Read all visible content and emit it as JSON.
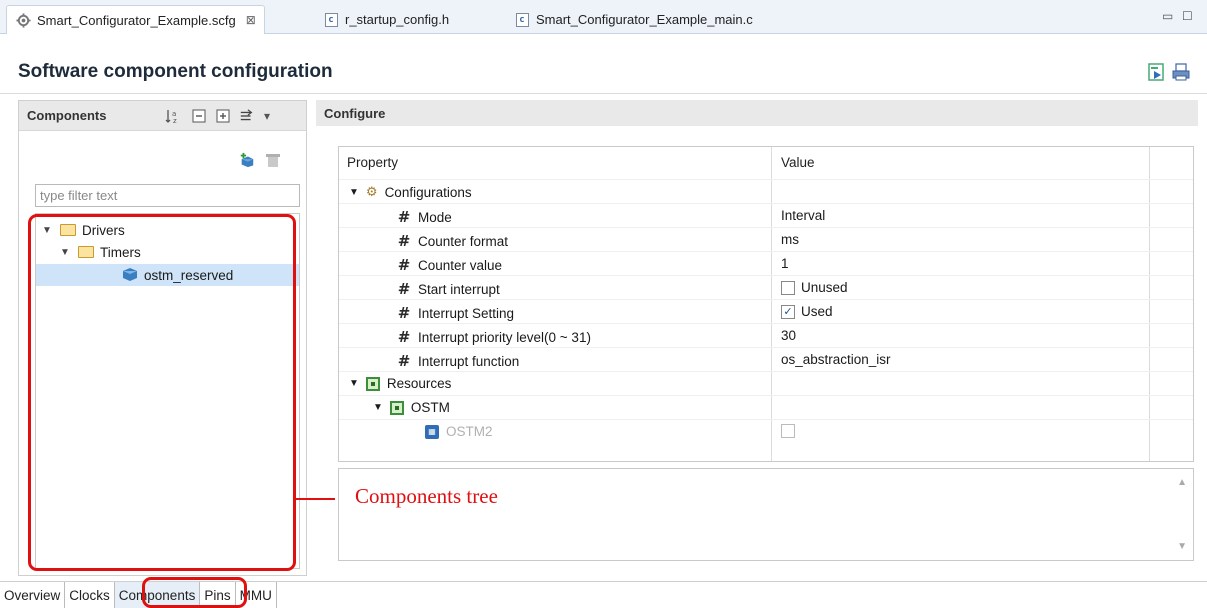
{
  "editor_tabs": [
    {
      "label": "Smart_Configurator_Example.scfg",
      "icon": "gear-icon",
      "close": "⊠"
    },
    {
      "label": "r_startup_config.h",
      "icon": "c-file-icon"
    },
    {
      "label": "Smart_Configurator_Example_main.c",
      "icon": "c-file-icon"
    }
  ],
  "window_controls": {
    "minimize": "▭",
    "maximize": "☐"
  },
  "page_title": "Software component configuration",
  "components_panel": {
    "title": "Components",
    "filter_placeholder": "type filter text",
    "tree": [
      {
        "label": "Drivers",
        "level": 0,
        "expanded": true,
        "icon": "folder-icon"
      },
      {
        "label": "Timers",
        "level": 1,
        "expanded": true,
        "icon": "folder-icon"
      },
      {
        "label": "ostm_reserved",
        "level": 2,
        "selected": true,
        "icon": "component-icon"
      }
    ]
  },
  "configure_panel": {
    "title": "Configure",
    "columns": {
      "property": "Property",
      "value": "Value"
    },
    "rows": [
      {
        "name": "Configurations",
        "type": "group",
        "value": ""
      },
      {
        "name": "Mode",
        "type": "prop",
        "value": "Interval"
      },
      {
        "name": "Counter format",
        "type": "prop",
        "value": "ms"
      },
      {
        "name": "Counter value",
        "type": "prop",
        "value": "1"
      },
      {
        "name": "Start interrupt",
        "type": "prop",
        "value": "Unused",
        "checked": false
      },
      {
        "name": "Interrupt Setting",
        "type": "prop",
        "value": "Used",
        "checked": true
      },
      {
        "name": "Interrupt priority level(0 ~ 31)",
        "type": "prop",
        "value": "30"
      },
      {
        "name": "Interrupt function",
        "type": "prop",
        "value": "os_abstraction_isr"
      },
      {
        "name": "Resources",
        "type": "group",
        "value": ""
      },
      {
        "name": "OSTM",
        "type": "subgroup",
        "value": ""
      },
      {
        "name": "OSTM2",
        "type": "resource",
        "value": "",
        "checked": false,
        "disabled": true
      }
    ]
  },
  "bottom_tabs": [
    "Overview",
    "Clocks",
    "Components",
    "Pins",
    "MMU"
  ],
  "active_bottom_tab": "Components",
  "annotation": {
    "label": "Components tree",
    "color": "#e01010"
  }
}
